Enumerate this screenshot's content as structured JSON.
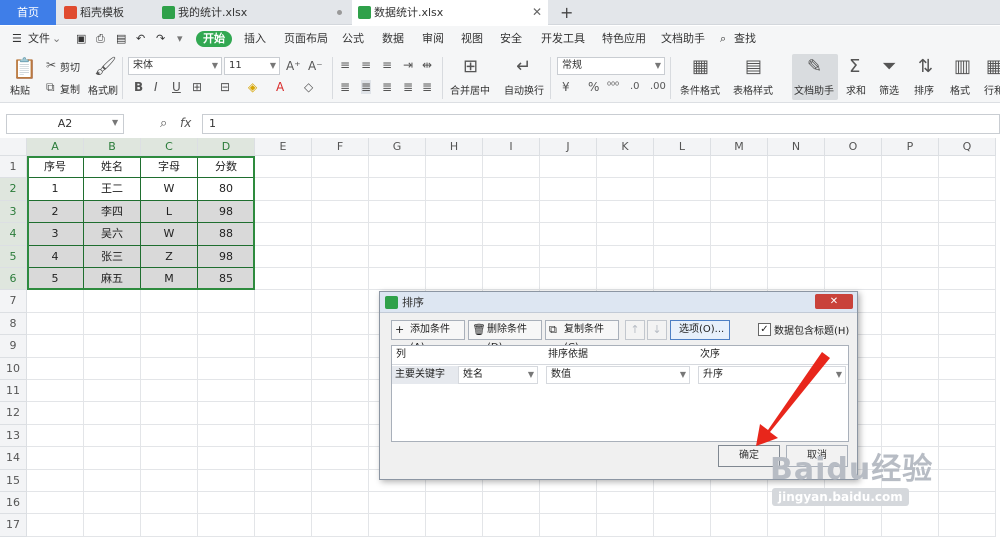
{
  "tabs": [
    {
      "label": "首页"
    },
    {
      "label": "稻壳模板",
      "icon": "docer-icon",
      "color": "#e04b2f"
    },
    {
      "label": "我的统计.xlsx",
      "icon": "sheet-icon",
      "color": "#2fa14a"
    },
    {
      "label": "数据统计.xlsx",
      "icon": "sheet-icon",
      "color": "#2fa14a"
    }
  ],
  "new_tab": "+",
  "menu": {
    "file": "文件",
    "items": [
      "开始",
      "插入",
      "页面布局",
      "公式",
      "数据",
      "审阅",
      "视图",
      "安全",
      "开发工具",
      "特色应用",
      "文档助手"
    ],
    "search": "查找"
  },
  "toolbar": {
    "cut": "剪切",
    "paste": "粘贴",
    "copy": "复制",
    "format_painter": "格式刷",
    "font_name": "宋体",
    "font_size": "11",
    "merge": "合并居中",
    "wrap": "自动换行",
    "number_format": "常规",
    "cond_format": "条件格式",
    "table_style": "表格样式",
    "doc_assistant": "文档助手",
    "sum": "求和",
    "filter": "筛选",
    "sort": "排序",
    "format": "格式",
    "rowcol": "行和"
  },
  "formula": {
    "cell_ref": "A2",
    "fx": "fx",
    "value": "1"
  },
  "columns": [
    "A",
    "B",
    "C",
    "D",
    "E",
    "F",
    "G",
    "H",
    "I",
    "J",
    "K",
    "L",
    "M",
    "N",
    "O",
    "P",
    "Q"
  ],
  "rows": [
    "1",
    "2",
    "3",
    "4",
    "5",
    "6",
    "7",
    "8",
    "9",
    "10",
    "11",
    "12",
    "13",
    "14",
    "15",
    "16",
    "17"
  ],
  "table": {
    "header": [
      "序号",
      "姓名",
      "字母",
      "分数"
    ],
    "data": [
      [
        "1",
        "王二",
        "W",
        "80"
      ],
      [
        "2",
        "李四",
        "L",
        "98"
      ],
      [
        "3",
        "吴六",
        "W",
        "88"
      ],
      [
        "4",
        "张三",
        "Z",
        "98"
      ],
      [
        "5",
        "麻五",
        "M",
        "85"
      ]
    ]
  },
  "dialog": {
    "title": "排序",
    "close": "✕",
    "add_condition": "添加条件(A)",
    "delete_condition": "删除条件(D)",
    "copy_condition": "复制条件(C)",
    "up": "↑",
    "down": "↓",
    "options": "选项(O)...",
    "has_header": "数据包含标题(H)",
    "has_header_checked": true,
    "col_header": "列",
    "sort_basis_header": "排序依据",
    "order_header": "次序",
    "primary_key": "主要关键字",
    "column_value": "姓名",
    "basis_value": "数值",
    "order_value": "升序",
    "ok": "确定",
    "cancel": "取消"
  },
  "watermark": {
    "line1": "Baidu经验",
    "line2": "jingyan.baidu.com"
  }
}
